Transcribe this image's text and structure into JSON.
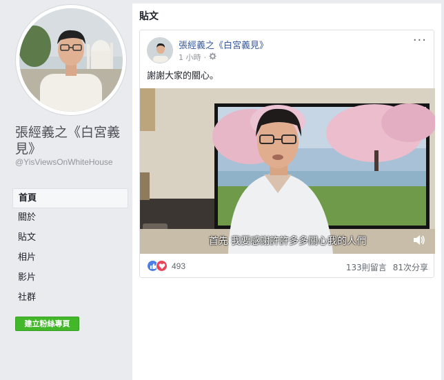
{
  "page": {
    "name": "張經義之《白宮義見》",
    "handle": "@YisViewsOnWhiteHouse"
  },
  "sidebar": {
    "items": [
      {
        "label": "首頁",
        "active": true
      },
      {
        "label": "關於"
      },
      {
        "label": "貼文"
      },
      {
        "label": "相片"
      },
      {
        "label": "影片"
      },
      {
        "label": "社群"
      }
    ],
    "create_button": "建立粉絲專頁"
  },
  "posts": {
    "header": "貼文",
    "post": {
      "author": "張經義之《白宮義見》",
      "time": "1 小時",
      "audience_icon": "gear-icon",
      "text": "謝謝大家的關心。",
      "video_subtitle": "首先  我要感謝許許多多關心我的人們",
      "reaction_count": "493",
      "comments": "133則留言",
      "shares": "81次分享"
    }
  },
  "colors": {
    "link": "#365899",
    "button_green": "#42b72a",
    "background": "#e9ebee"
  }
}
